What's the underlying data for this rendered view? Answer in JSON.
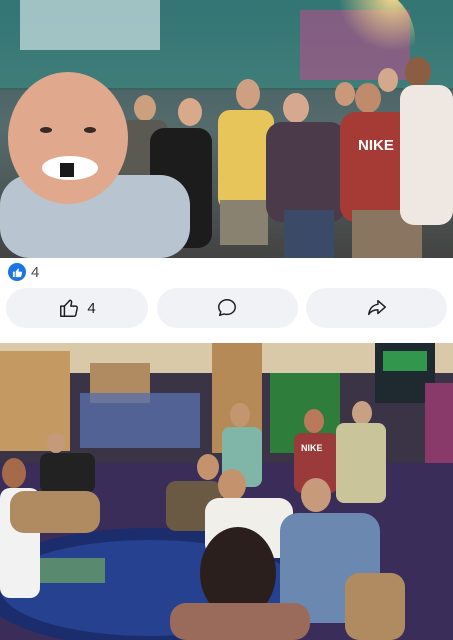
{
  "post": {
    "photo_top": {
      "description_icon": "group-selfie-photo",
      "shirt_text": "NIKE"
    },
    "photo_bottom": {
      "description_icon": "casino-table-photo",
      "shirt_text": "NIKE"
    }
  },
  "reactions": {
    "icon": "like-icon",
    "count": "4",
    "accent": "#1b74e4"
  },
  "actions": {
    "like": {
      "icon": "thumbs-up-icon",
      "count": "4"
    },
    "comment": {
      "icon": "comment-icon"
    },
    "share": {
      "icon": "share-icon"
    }
  }
}
